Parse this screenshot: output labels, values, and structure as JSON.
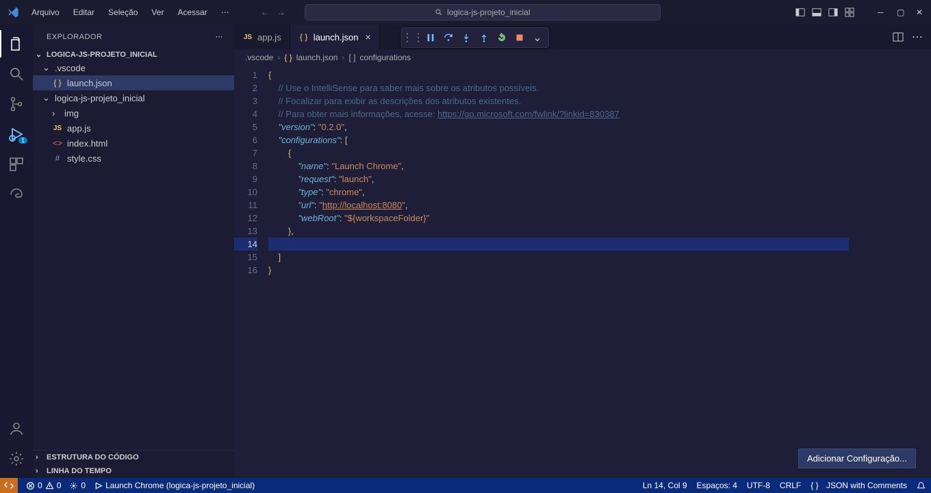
{
  "title_search": "logica-js-projeto_inicial",
  "menu": [
    "Arquivo",
    "Editar",
    "Seleção",
    "Ver",
    "Acessar"
  ],
  "sidebar": {
    "title": "EXPLORADOR",
    "project": "LOGICA-JS-PROJETO_INICIAL",
    "vscode_folder": ".vscode",
    "launch_file": "launch.json",
    "inner_folder": "logica-js-projeto_inicial",
    "img_folder": "img",
    "appjs": "app.js",
    "indexhtml": "index.html",
    "stylecss": "style.css",
    "outline": "ESTRUTURA DO CÓDIGO",
    "timeline": "LINHA DO TEMPO"
  },
  "tabs": {
    "appjs": "app.js",
    "launch": "launch.json"
  },
  "breadcrumb": {
    "p1": ".vscode",
    "p2": "launch.json",
    "p3": "configurations"
  },
  "code": {
    "l1": "{",
    "l2_c": "// Use o IntelliSense para saber mais sobre os atributos possíveis.",
    "l3_c": "// Focalizar para exibir as descrições dos atributos existentes.",
    "l4_c": "// Para obter mais informações, acesse: ",
    "l4_link": "https://go.microsoft.com/fwlink/?linkid=830387",
    "l5_k": "\"version\"",
    "l5_v": "\"0.2.0\"",
    "l6_k": "\"configurations\"",
    "l8_k": "\"name\"",
    "l8_v": "\"Launch Chrome\"",
    "l9_k": "\"request\"",
    "l9_v": "\"launch\"",
    "l10_k": "\"type\"",
    "l10_v": "\"chrome\"",
    "l11_k": "\"url\"",
    "l11_v": "http://localhost:8080",
    "l12_k": "\"webRoot\"",
    "l12_v": "\"${workspaceFolder}\""
  },
  "add_config": "Adicionar Configuração...",
  "debug_badge": "1",
  "status": {
    "errors": "0",
    "warnings": "0",
    "ports": "0",
    "launch": "Launch Chrome (logica-js-projeto_inicial)",
    "pos": "Ln 14, Col 9",
    "spaces": "Espaços: 4",
    "enc": "UTF-8",
    "eol": "CRLF",
    "lang": "JSON with Comments"
  }
}
